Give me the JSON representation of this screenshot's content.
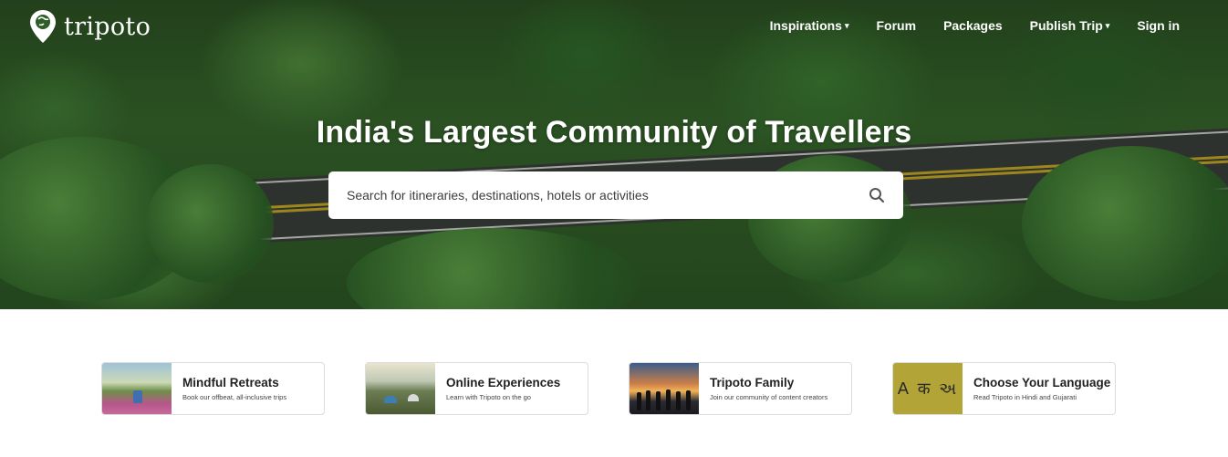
{
  "brand": {
    "name": "tripoto"
  },
  "nav": [
    {
      "label": "Inspirations",
      "dropdown": true
    },
    {
      "label": "Forum",
      "dropdown": false
    },
    {
      "label": "Packages",
      "dropdown": false
    },
    {
      "label": "Publish Trip",
      "dropdown": true
    },
    {
      "label": "Sign in",
      "dropdown": false
    }
  ],
  "hero": {
    "headline": "India's Largest Community of Travellers",
    "search_placeholder": "Search for itineraries, destinations, hotels or activities"
  },
  "cards": [
    {
      "title": "Mindful Retreats",
      "subtitle": "Book our offbeat, all-inclusive trips",
      "icon": "retreat-photo"
    },
    {
      "title": "Online Experiences",
      "subtitle": "Learn with Tripoto on the go",
      "icon": "camping-photo"
    },
    {
      "title": "Tripoto Family",
      "subtitle": "Join our community of content creators",
      "icon": "group-photo"
    },
    {
      "title": "Choose Your Language",
      "subtitle": "Read Tripoto in Hindi and Gujarati",
      "icon": "language-icon",
      "glyphs": "A क અ"
    }
  ],
  "colors": {
    "accent_language_tile": "#b3a437",
    "hero_overlay": "#2a4f22"
  }
}
